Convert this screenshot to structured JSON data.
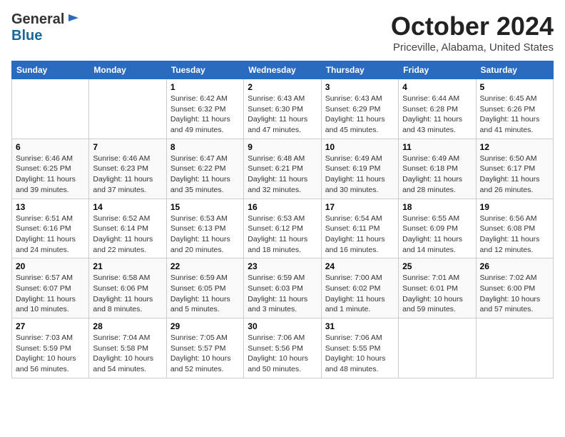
{
  "logo": {
    "general": "General",
    "blue": "Blue"
  },
  "header": {
    "month": "October 2024",
    "location": "Priceville, Alabama, United States"
  },
  "weekdays": [
    "Sunday",
    "Monday",
    "Tuesday",
    "Wednesday",
    "Thursday",
    "Friday",
    "Saturday"
  ],
  "weeks": [
    [
      {
        "day": "",
        "info": ""
      },
      {
        "day": "",
        "info": ""
      },
      {
        "day": "1",
        "info": "Sunrise: 6:42 AM\nSunset: 6:32 PM\nDaylight: 11 hours and 49 minutes."
      },
      {
        "day": "2",
        "info": "Sunrise: 6:43 AM\nSunset: 6:30 PM\nDaylight: 11 hours and 47 minutes."
      },
      {
        "day": "3",
        "info": "Sunrise: 6:43 AM\nSunset: 6:29 PM\nDaylight: 11 hours and 45 minutes."
      },
      {
        "day": "4",
        "info": "Sunrise: 6:44 AM\nSunset: 6:28 PM\nDaylight: 11 hours and 43 minutes."
      },
      {
        "day": "5",
        "info": "Sunrise: 6:45 AM\nSunset: 6:26 PM\nDaylight: 11 hours and 41 minutes."
      }
    ],
    [
      {
        "day": "6",
        "info": "Sunrise: 6:46 AM\nSunset: 6:25 PM\nDaylight: 11 hours and 39 minutes."
      },
      {
        "day": "7",
        "info": "Sunrise: 6:46 AM\nSunset: 6:23 PM\nDaylight: 11 hours and 37 minutes."
      },
      {
        "day": "8",
        "info": "Sunrise: 6:47 AM\nSunset: 6:22 PM\nDaylight: 11 hours and 35 minutes."
      },
      {
        "day": "9",
        "info": "Sunrise: 6:48 AM\nSunset: 6:21 PM\nDaylight: 11 hours and 32 minutes."
      },
      {
        "day": "10",
        "info": "Sunrise: 6:49 AM\nSunset: 6:19 PM\nDaylight: 11 hours and 30 minutes."
      },
      {
        "day": "11",
        "info": "Sunrise: 6:49 AM\nSunset: 6:18 PM\nDaylight: 11 hours and 28 minutes."
      },
      {
        "day": "12",
        "info": "Sunrise: 6:50 AM\nSunset: 6:17 PM\nDaylight: 11 hours and 26 minutes."
      }
    ],
    [
      {
        "day": "13",
        "info": "Sunrise: 6:51 AM\nSunset: 6:16 PM\nDaylight: 11 hours and 24 minutes."
      },
      {
        "day": "14",
        "info": "Sunrise: 6:52 AM\nSunset: 6:14 PM\nDaylight: 11 hours and 22 minutes."
      },
      {
        "day": "15",
        "info": "Sunrise: 6:53 AM\nSunset: 6:13 PM\nDaylight: 11 hours and 20 minutes."
      },
      {
        "day": "16",
        "info": "Sunrise: 6:53 AM\nSunset: 6:12 PM\nDaylight: 11 hours and 18 minutes."
      },
      {
        "day": "17",
        "info": "Sunrise: 6:54 AM\nSunset: 6:11 PM\nDaylight: 11 hours and 16 minutes."
      },
      {
        "day": "18",
        "info": "Sunrise: 6:55 AM\nSunset: 6:09 PM\nDaylight: 11 hours and 14 minutes."
      },
      {
        "day": "19",
        "info": "Sunrise: 6:56 AM\nSunset: 6:08 PM\nDaylight: 11 hours and 12 minutes."
      }
    ],
    [
      {
        "day": "20",
        "info": "Sunrise: 6:57 AM\nSunset: 6:07 PM\nDaylight: 11 hours and 10 minutes."
      },
      {
        "day": "21",
        "info": "Sunrise: 6:58 AM\nSunset: 6:06 PM\nDaylight: 11 hours and 8 minutes."
      },
      {
        "day": "22",
        "info": "Sunrise: 6:59 AM\nSunset: 6:05 PM\nDaylight: 11 hours and 5 minutes."
      },
      {
        "day": "23",
        "info": "Sunrise: 6:59 AM\nSunset: 6:03 PM\nDaylight: 11 hours and 3 minutes."
      },
      {
        "day": "24",
        "info": "Sunrise: 7:00 AM\nSunset: 6:02 PM\nDaylight: 11 hours and 1 minute."
      },
      {
        "day": "25",
        "info": "Sunrise: 7:01 AM\nSunset: 6:01 PM\nDaylight: 10 hours and 59 minutes."
      },
      {
        "day": "26",
        "info": "Sunrise: 7:02 AM\nSunset: 6:00 PM\nDaylight: 10 hours and 57 minutes."
      }
    ],
    [
      {
        "day": "27",
        "info": "Sunrise: 7:03 AM\nSunset: 5:59 PM\nDaylight: 10 hours and 56 minutes."
      },
      {
        "day": "28",
        "info": "Sunrise: 7:04 AM\nSunset: 5:58 PM\nDaylight: 10 hours and 54 minutes."
      },
      {
        "day": "29",
        "info": "Sunrise: 7:05 AM\nSunset: 5:57 PM\nDaylight: 10 hours and 52 minutes."
      },
      {
        "day": "30",
        "info": "Sunrise: 7:06 AM\nSunset: 5:56 PM\nDaylight: 10 hours and 50 minutes."
      },
      {
        "day": "31",
        "info": "Sunrise: 7:06 AM\nSunset: 5:55 PM\nDaylight: 10 hours and 48 minutes."
      },
      {
        "day": "",
        "info": ""
      },
      {
        "day": "",
        "info": ""
      }
    ]
  ]
}
